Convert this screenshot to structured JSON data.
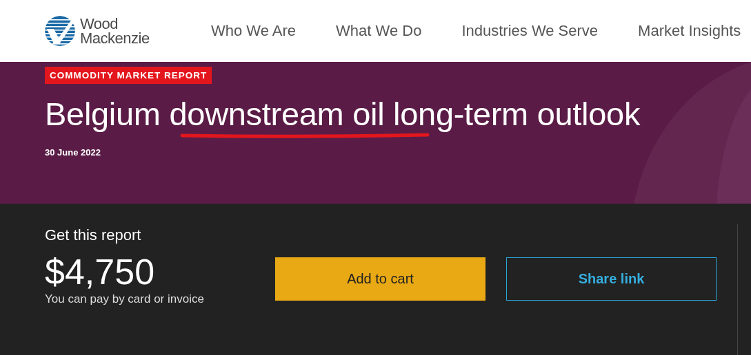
{
  "logo": {
    "lines": [
      "Wood",
      "Mackenzie"
    ]
  },
  "nav": [
    {
      "label": "Who We Are"
    },
    {
      "label": "What We Do"
    },
    {
      "label": "Industries We Serve"
    },
    {
      "label": "Market Insights"
    }
  ],
  "hero": {
    "badge": "COMMODITY MARKET REPORT",
    "title": "Belgium downstream oil long-term outlook",
    "date": "30 June 2022"
  },
  "purchase": {
    "heading": "Get this report",
    "price": "$4,750",
    "note": "You can pay by card or invoice",
    "buttons": [
      {
        "kind": "primary",
        "label": "Add to cart"
      },
      {
        "kind": "outline",
        "label": "Share link"
      }
    ]
  }
}
